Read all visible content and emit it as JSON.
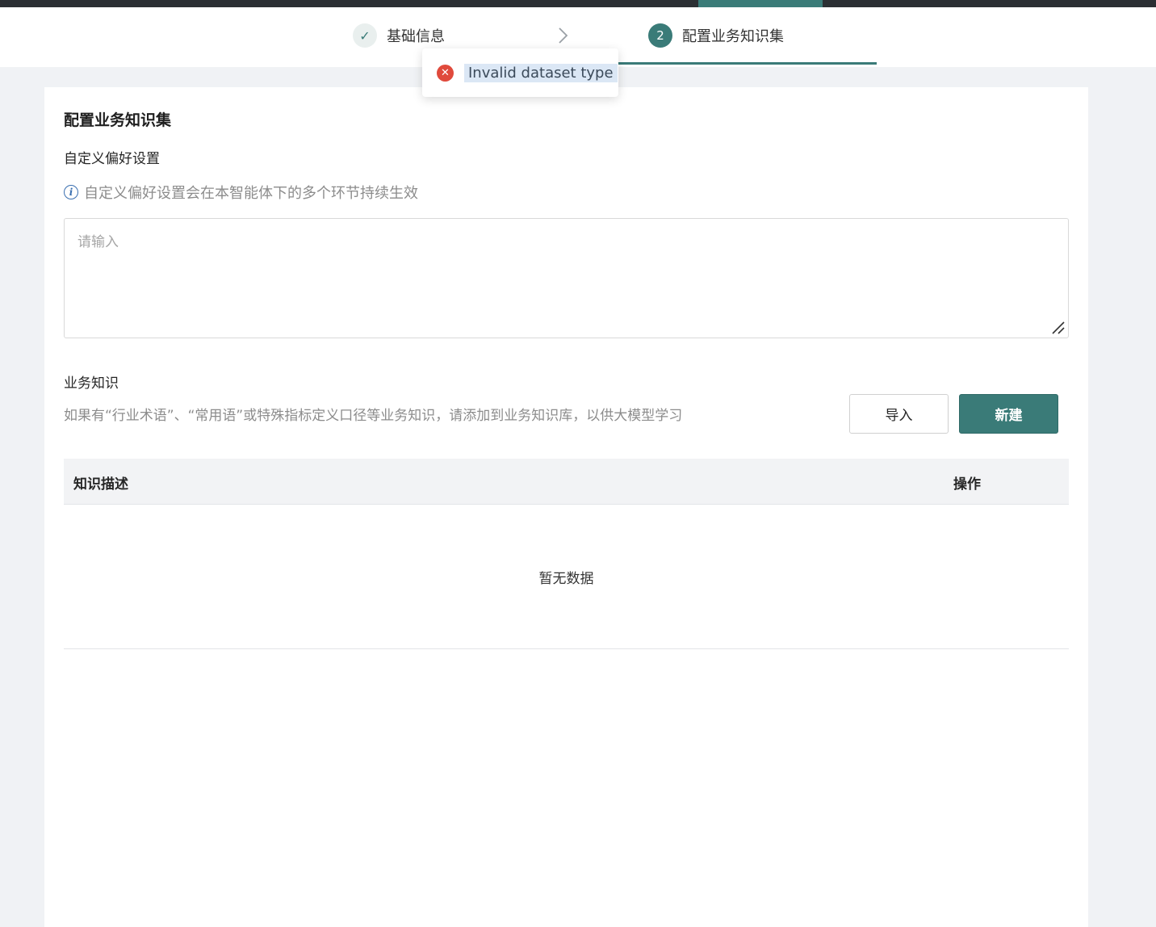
{
  "steps": [
    {
      "label": "基础信息",
      "state": "done"
    },
    {
      "label": "配置业务知识集",
      "number": "2",
      "state": "active"
    }
  ],
  "toast": {
    "message": "Invalid dataset type",
    "type": "error"
  },
  "card": {
    "title": "配置业务知识集",
    "preferences": {
      "label": "自定义偏好设置",
      "hint": "自定义偏好设置会在本智能体下的多个环节持续生效",
      "placeholder": "请输入",
      "value": ""
    },
    "knowledge": {
      "label": "业务知识",
      "hint": "如果有“行业术语”、“常用语”或特殊指标定义口径等业务知识，请添加到业务知识库，以供大模型学习",
      "import_label": "导入",
      "new_label": "新建"
    },
    "table": {
      "columns": [
        "知识描述",
        "操作"
      ],
      "rows": [],
      "empty_text": "暂无数据"
    }
  },
  "colors": {
    "accent": "#3a7b78",
    "error": "#e04a3c"
  }
}
